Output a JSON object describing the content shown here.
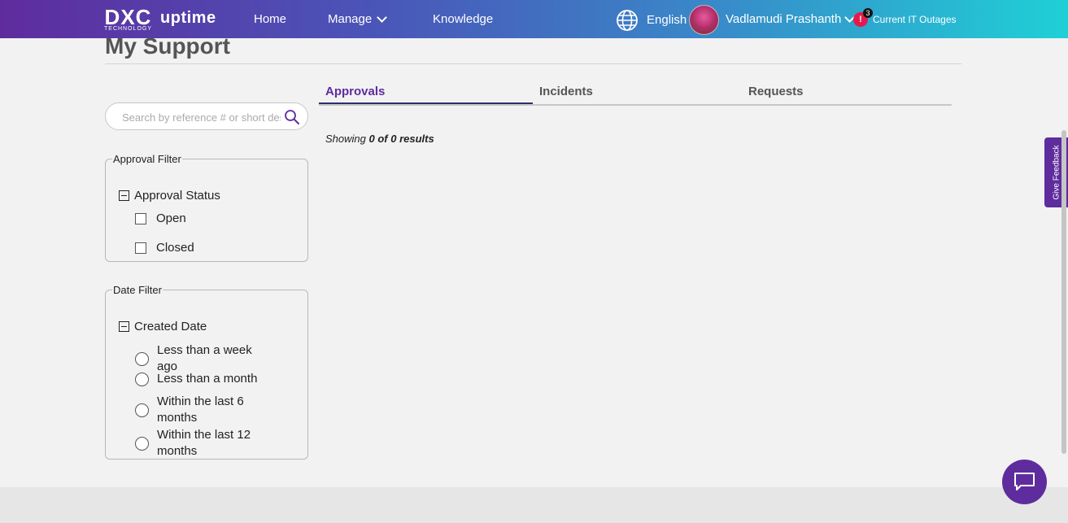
{
  "header": {
    "logo_mark": "DXC",
    "logo_sub": "TECHNOLOGY",
    "logo_app": "uptime",
    "nav": {
      "home": "Home",
      "manage": "Manage",
      "knowledge": "Knowledge"
    },
    "language": "English",
    "user_name": "Vadlamudi Prashanth",
    "outage_count": "3",
    "outage_symbol": "!",
    "outage_label": "Current IT Outages"
  },
  "page": {
    "title": "My Support"
  },
  "tabs": [
    {
      "label": "Approvals",
      "active": true
    },
    {
      "label": "Incidents",
      "active": false
    },
    {
      "label": "Requests",
      "active": false
    }
  ],
  "search": {
    "placeholder": "Search by reference # or short description",
    "value": ""
  },
  "results": {
    "prefix": "Showing",
    "range": "0 of 0 results"
  },
  "approval_filter": {
    "legend": "Approval Filter",
    "group": "Approval Status",
    "options": [
      "Open",
      "Closed"
    ]
  },
  "date_filter": {
    "legend": "Date Filter",
    "group": "Created Date",
    "options": [
      "Less than a week ago",
      "Less than a month",
      "Within the last 6 months",
      "Within the last 12 months"
    ]
  },
  "feedback": {
    "label": "Give Feedback"
  },
  "colors": {
    "accent": "#5f2c9e",
    "header_start": "#5f2c9e",
    "header_end": "#1fd0d6",
    "alert": "#e31b4d"
  }
}
